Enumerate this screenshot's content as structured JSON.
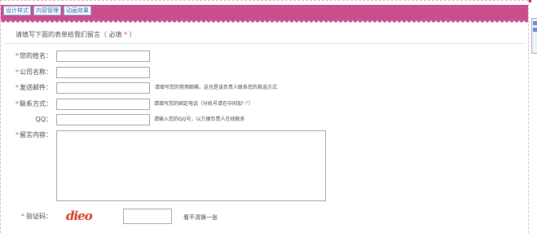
{
  "tabs": [
    {
      "label": "设计样式"
    },
    {
      "label": "内容管理"
    },
    {
      "label": "动画效果"
    }
  ],
  "intro": {
    "text": "请填写下面的表单给我们留言（ 必填 ",
    "required_mark": "*",
    "suffix": " ）"
  },
  "form": {
    "required_mark": "*",
    "name": {
      "label": "您的姓名："
    },
    "company": {
      "label": "公司名称："
    },
    "email": {
      "label": "发送邮件：",
      "hint": "请填写您的常用邮箱，这也是该负责人联系您的首选方式"
    },
    "phone": {
      "label": "联系方式：",
      "hint": "请填写您的固定电话（分机号请在中间加\"-\"）"
    },
    "qq": {
      "label": "QQ：",
      "hint": "请输入您的QQ号，以方便负责人在线联系"
    },
    "message": {
      "label": "留言内容："
    },
    "captcha": {
      "label": "验证码：",
      "image_text": "dieo",
      "refresh_label": "看不清换一张"
    }
  },
  "colors": {
    "header": "#c94e8c",
    "required": "#e0483a",
    "captcha": "#d63a24",
    "tab_text": "#2d63b3"
  }
}
